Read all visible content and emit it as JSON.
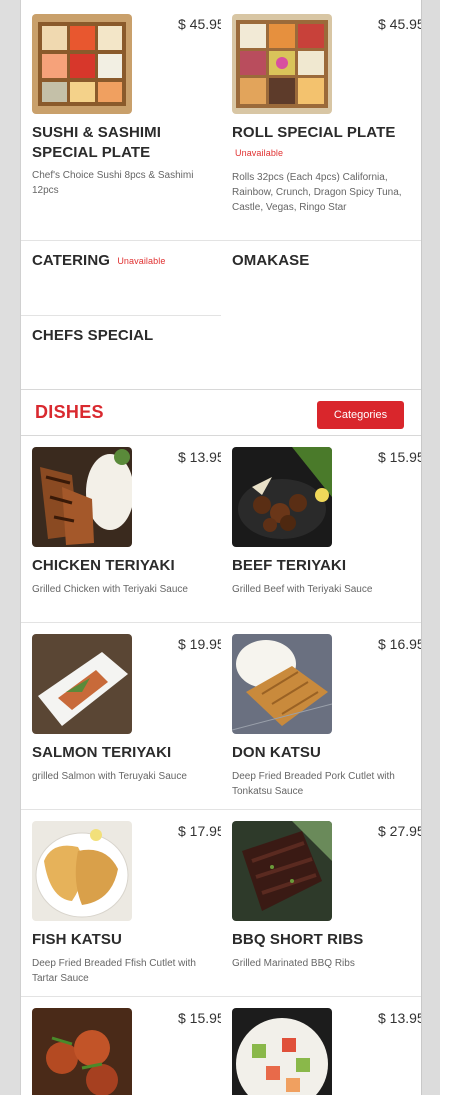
{
  "menu_items": [
    {
      "name": "SUSHI & SASHIMI SPECIAL PLATE",
      "price": "$ 45.95",
      "description": "Chef's Choice Sushi 8pcs & Sashimi 12pcs"
    },
    {
      "name": "ROLL SPECIAL PLATE",
      "price": "$ 45.95",
      "unavailable": "Unavailable",
      "description": "Rolls 32pcs (Each 4pcs) California, Rainbow, Crunch, Dragon Spicy Tuna, Castle, Vegas, Ringo Star"
    }
  ],
  "categories": {
    "catering": "CATERING",
    "catering_unavailable": "Unavailable",
    "omakase": "OMAKASE",
    "chefs_special": "CHEFS SPECIAL"
  },
  "dishes_section": {
    "title": "DISHES",
    "categories_button": "Categories"
  },
  "dishes": [
    {
      "name": "CHICKEN TERIYAKI",
      "price": "$ 13.95",
      "description": "Grilled Chicken with Teriyaki Sauce"
    },
    {
      "name": "BEEF TERIYAKI",
      "price": "$ 15.95",
      "description": "Grilled Beef with Teriyaki Sauce"
    },
    {
      "name": "SALMON TERIYAKI",
      "price": "$ 19.95",
      "description": "grilled Salmon with Teruyaki Sauce"
    },
    {
      "name": "DON KATSU",
      "price": "$ 16.95",
      "description": "Deep Fried Breaded Pork Cutlet with Tonkatsu Sauce"
    },
    {
      "name": "FISH KATSU",
      "price": "$ 17.95",
      "description": "Deep Fried Breaded Ffish Cutlet with Tartar Sauce"
    },
    {
      "name": "BBQ SHORT RIBS",
      "price": "$ 27.95",
      "description": "Grilled Marinated BBQ Ribs"
    },
    {
      "price": "$ 15.95"
    },
    {
      "price": "$ 13.95"
    }
  ]
}
